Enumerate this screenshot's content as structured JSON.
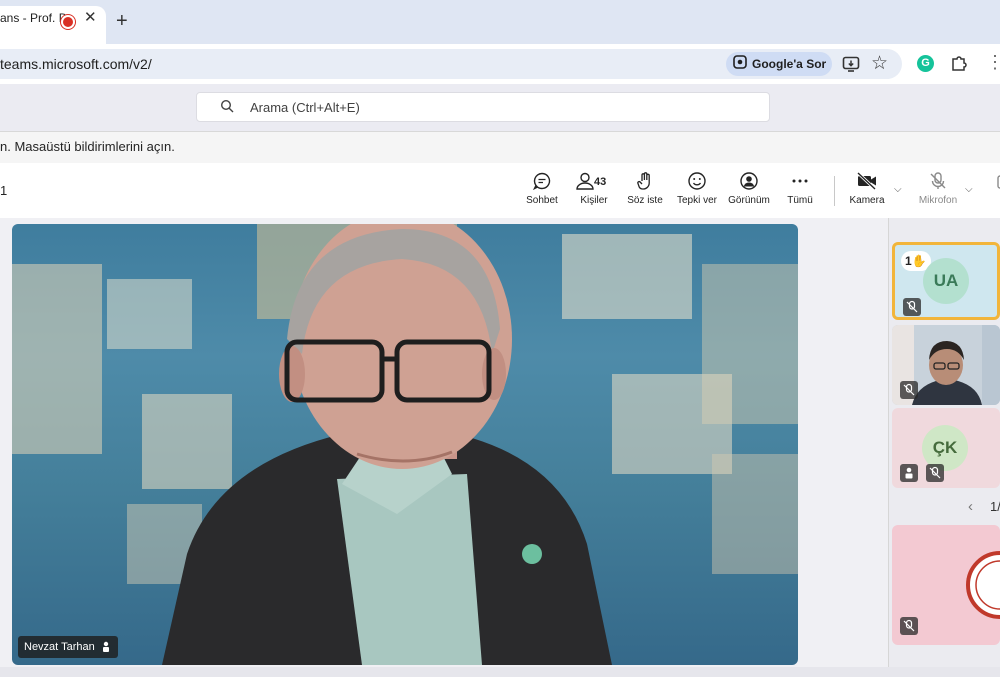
{
  "browser": {
    "tab_title": "ans - Prof. D",
    "url": "teams.microsoft.com/v2/",
    "google_button_label": "Google'a Sor"
  },
  "search": {
    "placeholder": "Arama (Ctrl+Alt+E)"
  },
  "notification": {
    "text": "n. Masaüstü bildirimlerini açın."
  },
  "meeting": {
    "timer": "1",
    "controls": {
      "chat_label": "Sohbet",
      "people_label": "Kişiler",
      "people_count": "43",
      "raise_hand_label": "Söz iste",
      "react_label": "Tepki ver",
      "view_label": "Görünüm",
      "more_label": "Tümü",
      "camera_label": "Kamera",
      "mic_label": "Mikrofon"
    }
  },
  "stage": {
    "speaker_name": "Nevzat Tarhan"
  },
  "gallery": {
    "tiles": [
      {
        "initials": "UA",
        "raised_hand_count": "1"
      },
      {
        "initials": ""
      },
      {
        "initials": "ÇK"
      }
    ],
    "pager": "1/"
  },
  "colors": {
    "accent": "#5b5fc7",
    "raised_hand_border": "#f2b53a",
    "recording": "#d93025"
  }
}
